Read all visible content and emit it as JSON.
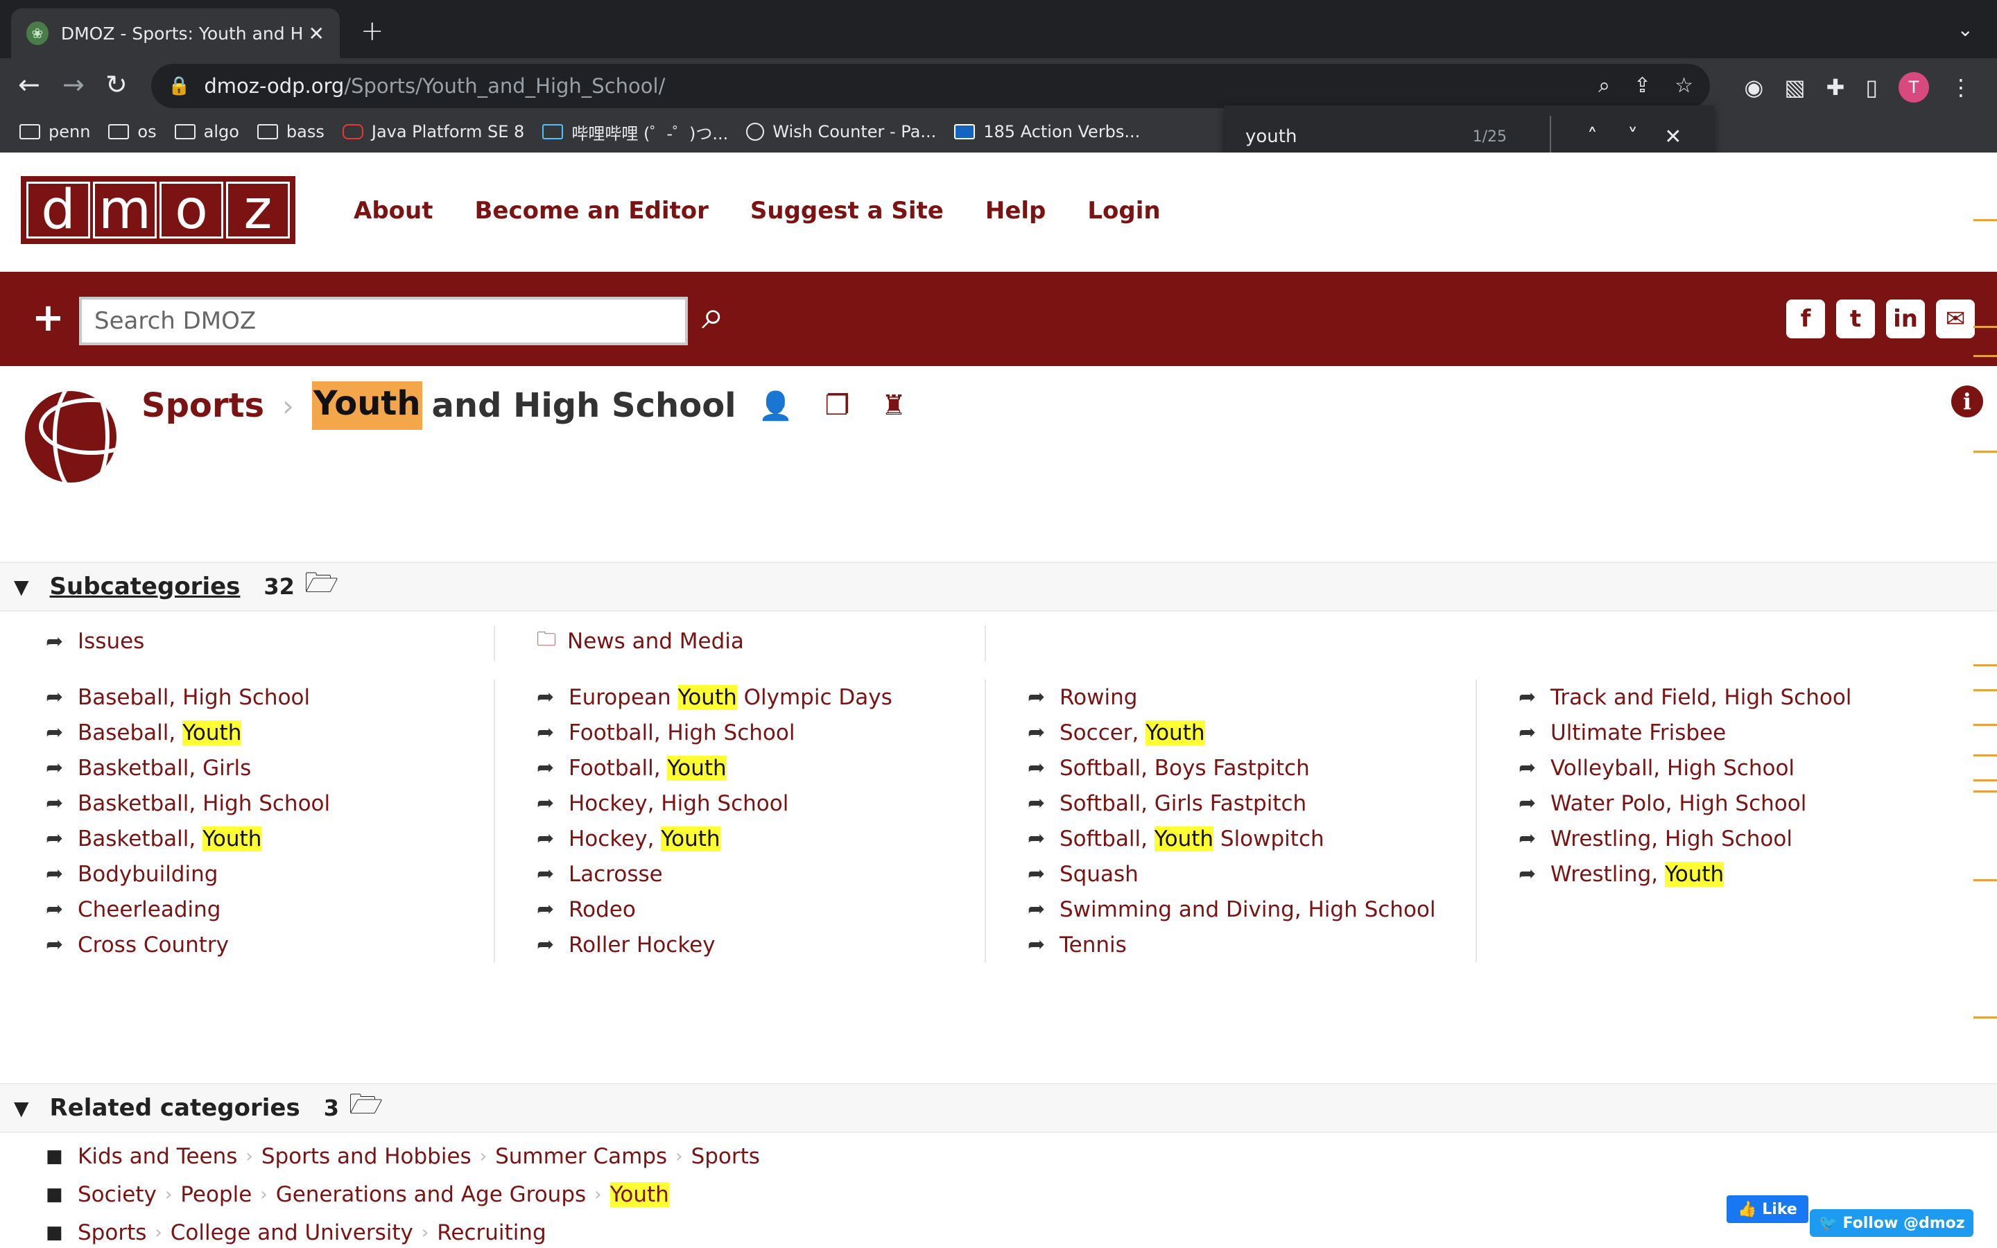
{
  "browser": {
    "tab_title": "DMOZ - Sports: Youth and High School",
    "new_tab_symbol": "+",
    "url_host": "dmoz-odp.org",
    "url_path": "/Sports/Youth_and_High_School/",
    "bookmarks": [
      {
        "label": "penn",
        "icon": "folder-icon"
      },
      {
        "label": "os",
        "icon": "folder-icon"
      },
      {
        "label": "algo",
        "icon": "folder-icon"
      },
      {
        "label": "bass",
        "icon": "folder-icon"
      },
      {
        "label": "Java Platform SE 8",
        "icon": "oracle-icon"
      },
      {
        "label": "哔哩哔哩 (゜-゜)つ...",
        "icon": "bilibili-icon"
      },
      {
        "label": "Wish Counter - Pa...",
        "icon": "wish-icon"
      },
      {
        "label": "185 Action Verbs...",
        "icon": "doc-icon"
      }
    ],
    "avatar_letter": "T",
    "find": {
      "query": "youth",
      "count": "1/25"
    }
  },
  "site": {
    "logo_letters": [
      "d",
      "m",
      "o",
      "z"
    ],
    "nav": [
      "About",
      "Become an Editor",
      "Suggest a Site",
      "Help",
      "Login"
    ],
    "search_placeholder": "Search DMOZ",
    "social": [
      "f",
      "t",
      "in",
      "✉"
    ]
  },
  "breadcrumb": {
    "parent": "Sports",
    "current_highlight": "Youth",
    "current_rest": "and High School"
  },
  "subcategories": {
    "title": "Subcategories",
    "count": "32",
    "top": [
      "Issues",
      "News and Media"
    ],
    "columns": [
      [
        {
          "pre": "Baseball, High School",
          "hl": "",
          "post": ""
        },
        {
          "pre": "Baseball, ",
          "hl": "Youth",
          "post": ""
        },
        {
          "pre": "Basketball, Girls",
          "hl": "",
          "post": ""
        },
        {
          "pre": "Basketball, High School",
          "hl": "",
          "post": ""
        },
        {
          "pre": "Basketball, ",
          "hl": "Youth",
          "post": ""
        },
        {
          "pre": "Bodybuilding",
          "hl": "",
          "post": ""
        },
        {
          "pre": "Cheerleading",
          "hl": "",
          "post": ""
        },
        {
          "pre": "Cross Country",
          "hl": "",
          "post": ""
        }
      ],
      [
        {
          "pre": "European ",
          "hl": "Youth",
          "post": " Olympic Days"
        },
        {
          "pre": "Football, High School",
          "hl": "",
          "post": ""
        },
        {
          "pre": "Football, ",
          "hl": "Youth",
          "post": ""
        },
        {
          "pre": "Hockey, High School",
          "hl": "",
          "post": ""
        },
        {
          "pre": "Hockey, ",
          "hl": "Youth",
          "post": ""
        },
        {
          "pre": "Lacrosse",
          "hl": "",
          "post": ""
        },
        {
          "pre": "Rodeo",
          "hl": "",
          "post": ""
        },
        {
          "pre": "Roller Hockey",
          "hl": "",
          "post": ""
        }
      ],
      [
        {
          "pre": "Rowing",
          "hl": "",
          "post": ""
        },
        {
          "pre": "Soccer, ",
          "hl": "Youth",
          "post": ""
        },
        {
          "pre": "Softball, Boys Fastpitch",
          "hl": "",
          "post": ""
        },
        {
          "pre": "Softball, Girls Fastpitch",
          "hl": "",
          "post": ""
        },
        {
          "pre": "Softball, ",
          "hl": "Youth",
          "post": " Slowpitch"
        },
        {
          "pre": "Squash",
          "hl": "",
          "post": ""
        },
        {
          "pre": "Swimming and Diving, High School",
          "hl": "",
          "post": ""
        },
        {
          "pre": "Tennis",
          "hl": "",
          "post": ""
        }
      ],
      [
        {
          "pre": "Track and Field, High School",
          "hl": "",
          "post": ""
        },
        {
          "pre": "Ultimate Frisbee",
          "hl": "",
          "post": ""
        },
        {
          "pre": "Volleyball, High School",
          "hl": "",
          "post": ""
        },
        {
          "pre": "Water Polo, High School",
          "hl": "",
          "post": ""
        },
        {
          "pre": "Wrestling, High School",
          "hl": "",
          "post": ""
        },
        {
          "pre": "Wrestling, ",
          "hl": "Youth",
          "post": ""
        }
      ]
    ]
  },
  "related": {
    "title": "Related categories",
    "count": "3",
    "rows": [
      [
        {
          "text": "Kids and Teens",
          "hl": false
        },
        {
          "text": "Sports and Hobbies",
          "hl": false
        },
        {
          "text": "Summer Camps",
          "hl": false
        },
        {
          "text": "Sports",
          "hl": false
        }
      ],
      [
        {
          "text": "Society",
          "hl": false
        },
        {
          "text": "People",
          "hl": false
        },
        {
          "text": "Generations and Age Groups",
          "hl": false
        },
        {
          "text": "Youth",
          "hl": true
        }
      ],
      [
        {
          "text": "Sports",
          "hl": false
        },
        {
          "text": "College and University",
          "hl": false
        },
        {
          "text": "Recruiting",
          "hl": false
        }
      ]
    ]
  },
  "widgets": {
    "like": "Like",
    "follow": "Follow @dmoz"
  },
  "colors": {
    "brand": "#7b1313",
    "highlight": "#ffff33",
    "current_highlight": "#f4a64b"
  }
}
